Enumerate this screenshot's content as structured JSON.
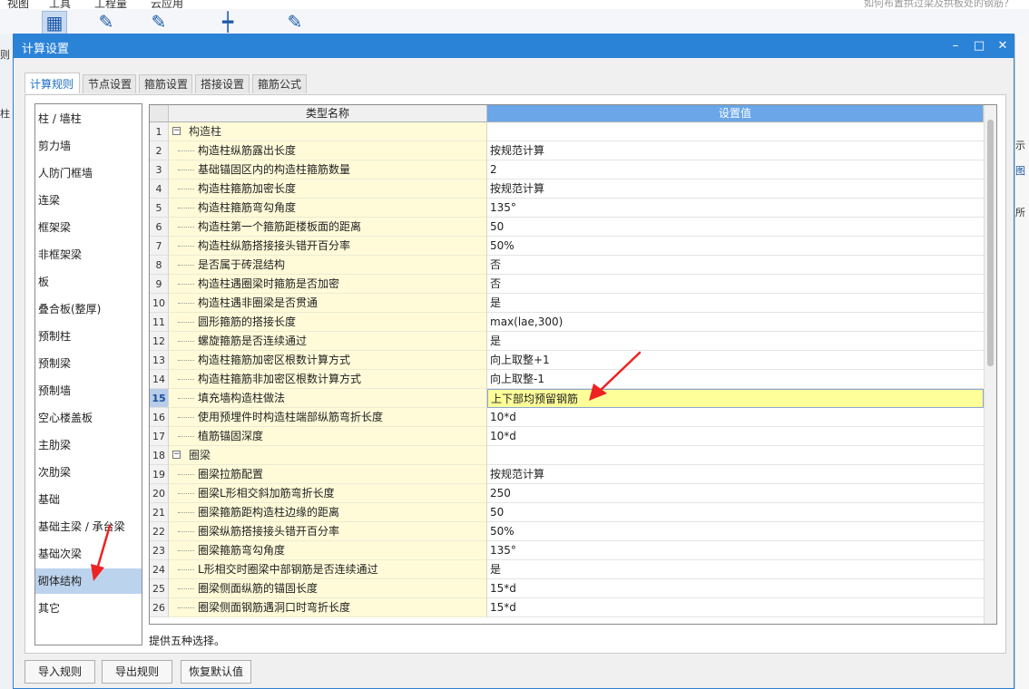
{
  "background_app": {
    "menu": [
      "视图",
      "工具",
      "工程量",
      "云应用"
    ],
    "search_hint": "如何布置拱过梁及拱板处的钢筋？",
    "left_edge_labels": [
      "则",
      "柱"
    ],
    "right_edge_labels": [
      "示",
      "图",
      "所"
    ]
  },
  "dialog": {
    "title": "计算设置",
    "minimize_glyph": "–",
    "maximize_glyph": "□",
    "close_glyph": "✕"
  },
  "tabs": [
    {
      "label": "计算规则",
      "active": true
    },
    {
      "label": "节点设置",
      "active": false
    },
    {
      "label": "箍筋设置",
      "active": false
    },
    {
      "label": "搭接设置",
      "active": false
    },
    {
      "label": "箍筋公式",
      "active": false
    }
  ],
  "categories": [
    "柱 / 墙柱",
    "剪力墙",
    "人防门框墙",
    "连梁",
    "框架梁",
    "非框架梁",
    "板",
    "叠合板(整厚)",
    "预制柱",
    "预制梁",
    "预制墙",
    "空心楼盖板",
    "主肋梁",
    "次肋梁",
    "基础",
    "基础主梁 / 承台梁",
    "基础次梁",
    "砌体结构",
    "其它"
  ],
  "selected_category": "砌体结构",
  "grid": {
    "col_name": "类型名称",
    "col_value": "设置值",
    "rows": [
      {
        "n": "1",
        "type": "group",
        "name": "构造柱",
        "value": ""
      },
      {
        "n": "2",
        "name": "构造柱纵筋露出长度",
        "value": "按规范计算"
      },
      {
        "n": "3",
        "name": "基础锚固区内的构造柱箍筋数量",
        "value": "2"
      },
      {
        "n": "4",
        "name": "构造柱箍筋加密长度",
        "value": "按规范计算"
      },
      {
        "n": "5",
        "name": "构造柱箍筋弯勾角度",
        "value": "135°"
      },
      {
        "n": "6",
        "name": "构造柱第一个箍筋距楼板面的距离",
        "value": "50"
      },
      {
        "n": "7",
        "name": "构造柱纵筋搭接接头错开百分率",
        "value": "50%"
      },
      {
        "n": "8",
        "name": "是否属于砖混结构",
        "value": "否"
      },
      {
        "n": "9",
        "name": "构造柱遇圈梁时箍筋是否加密",
        "value": "否"
      },
      {
        "n": "10",
        "name": "构造柱遇非圈梁是否贯通",
        "value": "是"
      },
      {
        "n": "11",
        "name": "圆形箍筋的搭接长度",
        "value": "max(lae,300)"
      },
      {
        "n": "12",
        "name": "螺旋箍筋是否连续通过",
        "value": "是"
      },
      {
        "n": "13",
        "name": "构造柱箍筋加密区根数计算方式",
        "value": "向上取整+1"
      },
      {
        "n": "14",
        "name": "构造柱箍筋非加密区根数计算方式",
        "value": "向上取整-1"
      },
      {
        "n": "15",
        "name": "填充墙构造柱做法",
        "value": "上下部均预留钢筋",
        "active": true
      },
      {
        "n": "16",
        "name": "使用预埋件时构造柱端部纵筋弯折长度",
        "value": "10*d"
      },
      {
        "n": "17",
        "name": "植筋锚固深度",
        "value": "10*d"
      },
      {
        "n": "18",
        "type": "group",
        "name": "圈梁",
        "value": ""
      },
      {
        "n": "19",
        "name": "圈梁拉筋配置",
        "value": "按规范计算"
      },
      {
        "n": "20",
        "name": "圈梁L形相交斜加筋弯折长度",
        "value": "250"
      },
      {
        "n": "21",
        "name": "圈梁箍筋距构造柱边缘的距离",
        "value": "50"
      },
      {
        "n": "22",
        "name": "圈梁纵筋搭接接头错开百分率",
        "value": "50%"
      },
      {
        "n": "23",
        "name": "圈梁箍筋弯勾角度",
        "value": "135°"
      },
      {
        "n": "24",
        "name": "L形相交时圈梁中部钢筋是否连续通过",
        "value": "是"
      },
      {
        "n": "25",
        "name": "圈梁侧面纵筋的锚固长度",
        "value": "15*d"
      },
      {
        "n": "26",
        "name": "圈梁侧面钢筋遇洞口时弯折长度",
        "value": "15*d"
      }
    ]
  },
  "description": "提供五种选择。",
  "buttons": [
    "导入规则",
    "导出规则",
    "恢复默认值"
  ],
  "colors": {
    "title_bar": "#2b83d8",
    "header_active": "#6aa6e8",
    "highlight_row": "#ffff99",
    "annotation_arrow": "#ee2222"
  }
}
